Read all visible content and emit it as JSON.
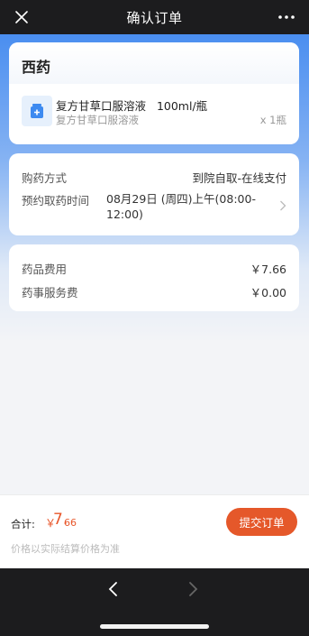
{
  "header": {
    "title": "确认订单"
  },
  "drug_card": {
    "section_title": "西药",
    "item": {
      "name": "复方甘草口服溶液",
      "spec": "100ml/瓶",
      "subtitle": "复方甘草口服溶液",
      "quantity": "x 1瓶",
      "icon": "medicine-icon"
    }
  },
  "purchase": {
    "method_label": "购药方式",
    "method_value": "到院自取-在线支付",
    "time_label": "预约取药时间",
    "time_value_line1": "08月29日 (周四)上午(08:00-",
    "time_value_line2": "12:00)"
  },
  "fees": {
    "drug_fee_label": "药品费用",
    "drug_fee_value": "￥7.66",
    "service_fee_label": "药事服务费",
    "service_fee_value": "￥0.00"
  },
  "bottom": {
    "total_label": "合计:",
    "currency": "￥",
    "total_int": "7.",
    "total_dec": "66",
    "note": "价格以实际结算价格为准",
    "submit_label": "提交订单"
  },
  "colors": {
    "accent": "#e5582a",
    "header_blue": "#4a8ef0"
  }
}
